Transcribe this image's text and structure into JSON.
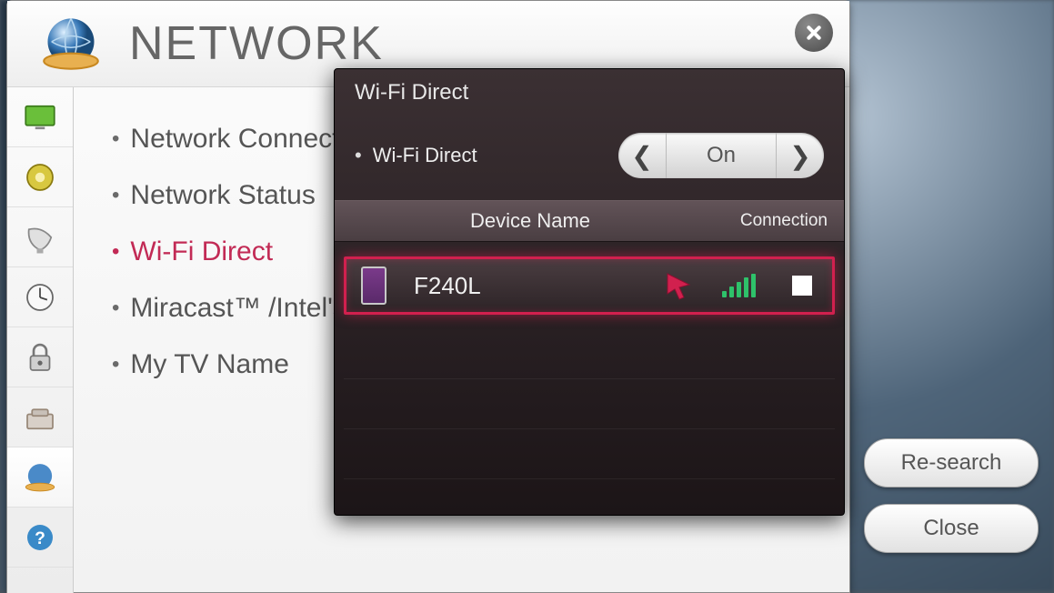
{
  "window": {
    "title": "NETWORK"
  },
  "sidebar": {
    "icons": [
      "tv",
      "disc",
      "satellite",
      "clock",
      "lock",
      "briefcase",
      "globe",
      "help"
    ]
  },
  "menu": {
    "items": [
      {
        "label": "Network Connection",
        "selected": false
      },
      {
        "label": "Network Status",
        "selected": false
      },
      {
        "label": "Wi-Fi Direct",
        "selected": true
      },
      {
        "label": "Miracast™ /Intel's WiDi",
        "selected": false
      },
      {
        "label": "My TV Name",
        "selected": false
      }
    ]
  },
  "modal": {
    "title": "Wi-Fi Direct",
    "toggle_label": "Wi-Fi Direct",
    "toggle_value": "On",
    "header_device": "Device Name",
    "header_connection": "Connection",
    "device": {
      "name": "F240L",
      "signal_bars": 5,
      "connected": false
    }
  },
  "buttons": {
    "research": "Re-search",
    "close": "Close"
  }
}
